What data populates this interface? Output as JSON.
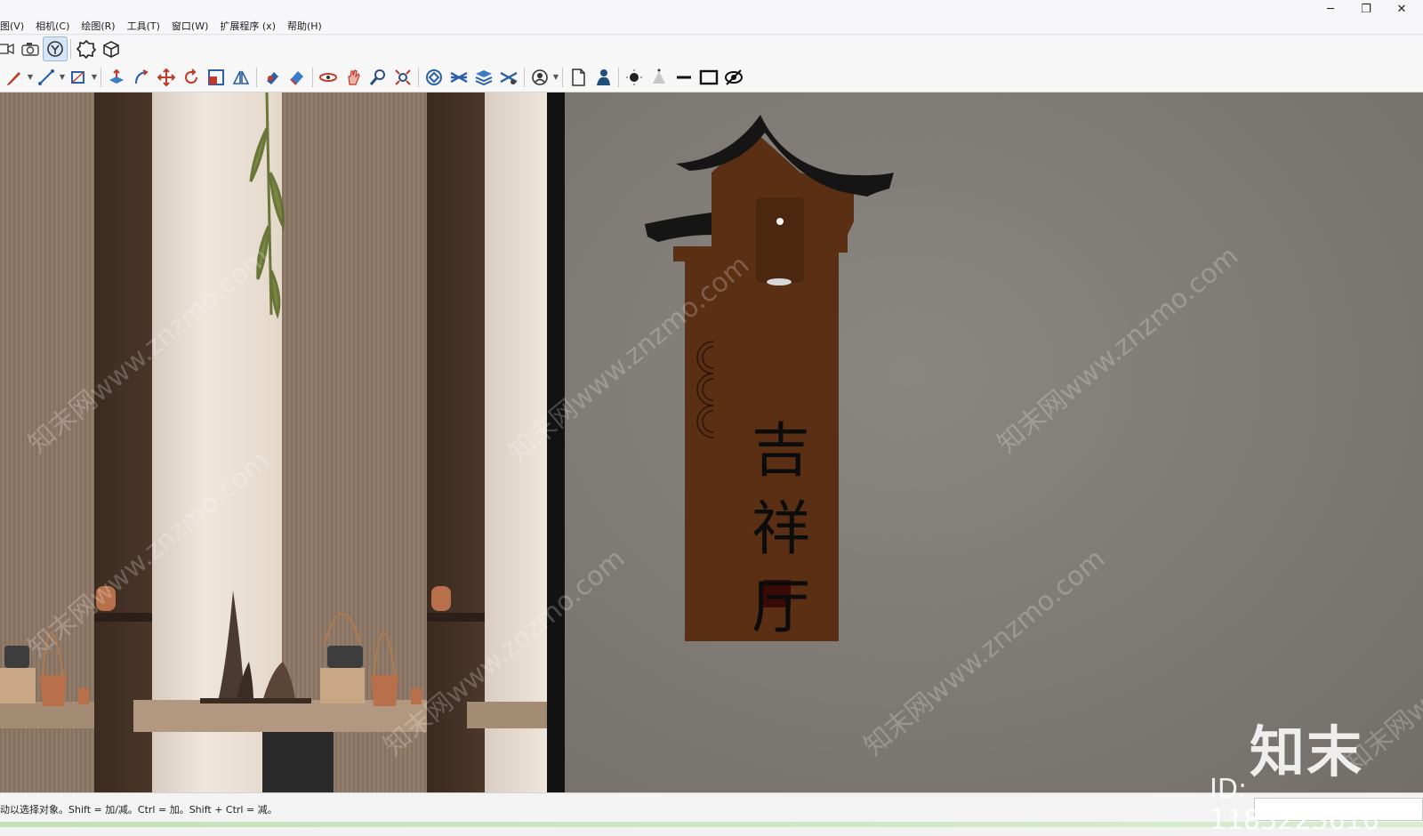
{
  "menu": {
    "items": [
      "图(V)",
      "相机(C)",
      "绘图(R)",
      "工具(T)",
      "窗口(W)",
      "扩展程序 (x)",
      "帮助(H)"
    ]
  },
  "window_controls": {
    "minimize": "─",
    "restore": "❐",
    "close": "✕"
  },
  "toolbar1": {
    "icons": [
      "camera-previous-icon",
      "camera-icon",
      "zoom-extents-icon",
      "component-icon",
      "section-box-icon"
    ]
  },
  "toolbar2": {
    "icons": [
      "pencil-icon",
      "line-icon",
      "rectangle-icon",
      "push-pull-icon",
      "follow-me-icon",
      "move-icon",
      "rotate-icon",
      "scale-icon",
      "mirror-icon",
      "paint-icon",
      "eraser-icon",
      "orbit-icon",
      "pan-icon",
      "zoom-icon",
      "zoom-window-icon",
      "tag-icon",
      "layers-icon",
      "layers-stack-icon",
      "layer-settings-icon",
      "user-circle-icon",
      "page-icon",
      "person-icon",
      "point-icon",
      "cone-icon",
      "line-segment-icon",
      "square-icon",
      "hide-icon"
    ]
  },
  "sign": {
    "characters": [
      "吉",
      "祥",
      "厅"
    ],
    "wood_color": "#5a2f14",
    "roof_color": "#151515",
    "seal_color": "#3a0a08"
  },
  "watermark": {
    "text": "知末网www.znzmo.com",
    "logo": "知末",
    "id": "ID: 1183223616"
  },
  "status": {
    "text": "动以选择对象。Shift = 加/减。Ctrl = 加。Shift + Ctrl = 减。"
  },
  "colors": {
    "wall": "#7d7975",
    "selected_tool": "#d6e6f7"
  }
}
